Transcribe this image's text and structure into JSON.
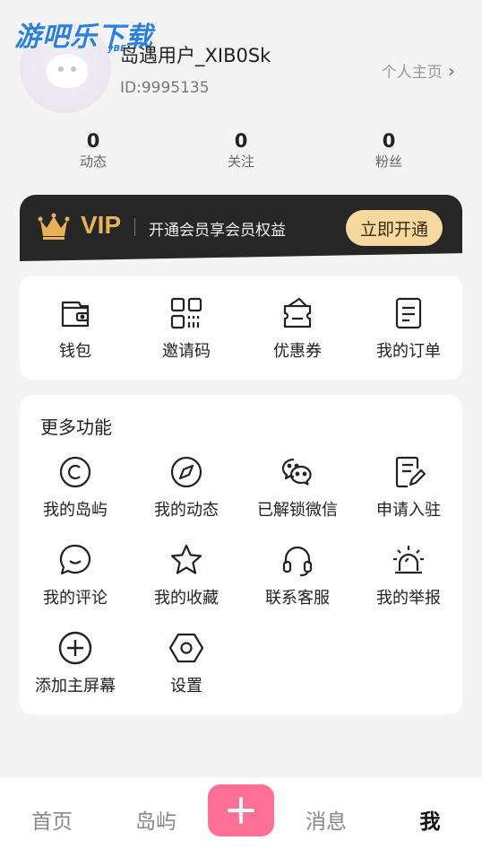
{
  "watermark": {
    "main": "游吧乐下载",
    "sub": "yBE"
  },
  "profile": {
    "username": "岛遇用户_XIB0Sk",
    "user_id": "ID:9995135",
    "homepage_label": "个人主页"
  },
  "stats": [
    {
      "value": "0",
      "label": "动态"
    },
    {
      "value": "0",
      "label": "关注"
    },
    {
      "value": "0",
      "label": "粉丝"
    }
  ],
  "vip": {
    "badge": "VIP",
    "description": "开通会员享会员权益",
    "button_label": "立即开通",
    "accent_color": "#e9b25a"
  },
  "quick_actions": [
    {
      "label": "钱包",
      "icon": "wallet-icon"
    },
    {
      "label": "邀请码",
      "icon": "qrcode-icon"
    },
    {
      "label": "优惠券",
      "icon": "coupon-icon"
    },
    {
      "label": "我的订单",
      "icon": "order-icon"
    }
  ],
  "more": {
    "title": "更多功能",
    "items": [
      {
        "label": "我的岛屿",
        "icon": "island-icon"
      },
      {
        "label": "我的动态",
        "icon": "compass-icon"
      },
      {
        "label": "已解锁微信",
        "icon": "wechat-icon"
      },
      {
        "label": "申请入驻",
        "icon": "apply-icon"
      },
      {
        "label": "我的评论",
        "icon": "comment-icon"
      },
      {
        "label": "我的收藏",
        "icon": "star-icon"
      },
      {
        "label": "联系客服",
        "icon": "headset-icon"
      },
      {
        "label": "我的举报",
        "icon": "alarm-icon"
      },
      {
        "label": "添加主屏幕",
        "icon": "add-circle-icon"
      },
      {
        "label": "设置",
        "icon": "settings-icon"
      }
    ]
  },
  "nav": {
    "home": "首页",
    "island": "岛屿",
    "messages": "消息",
    "me": "我",
    "plus_color": "#ff6f96"
  }
}
